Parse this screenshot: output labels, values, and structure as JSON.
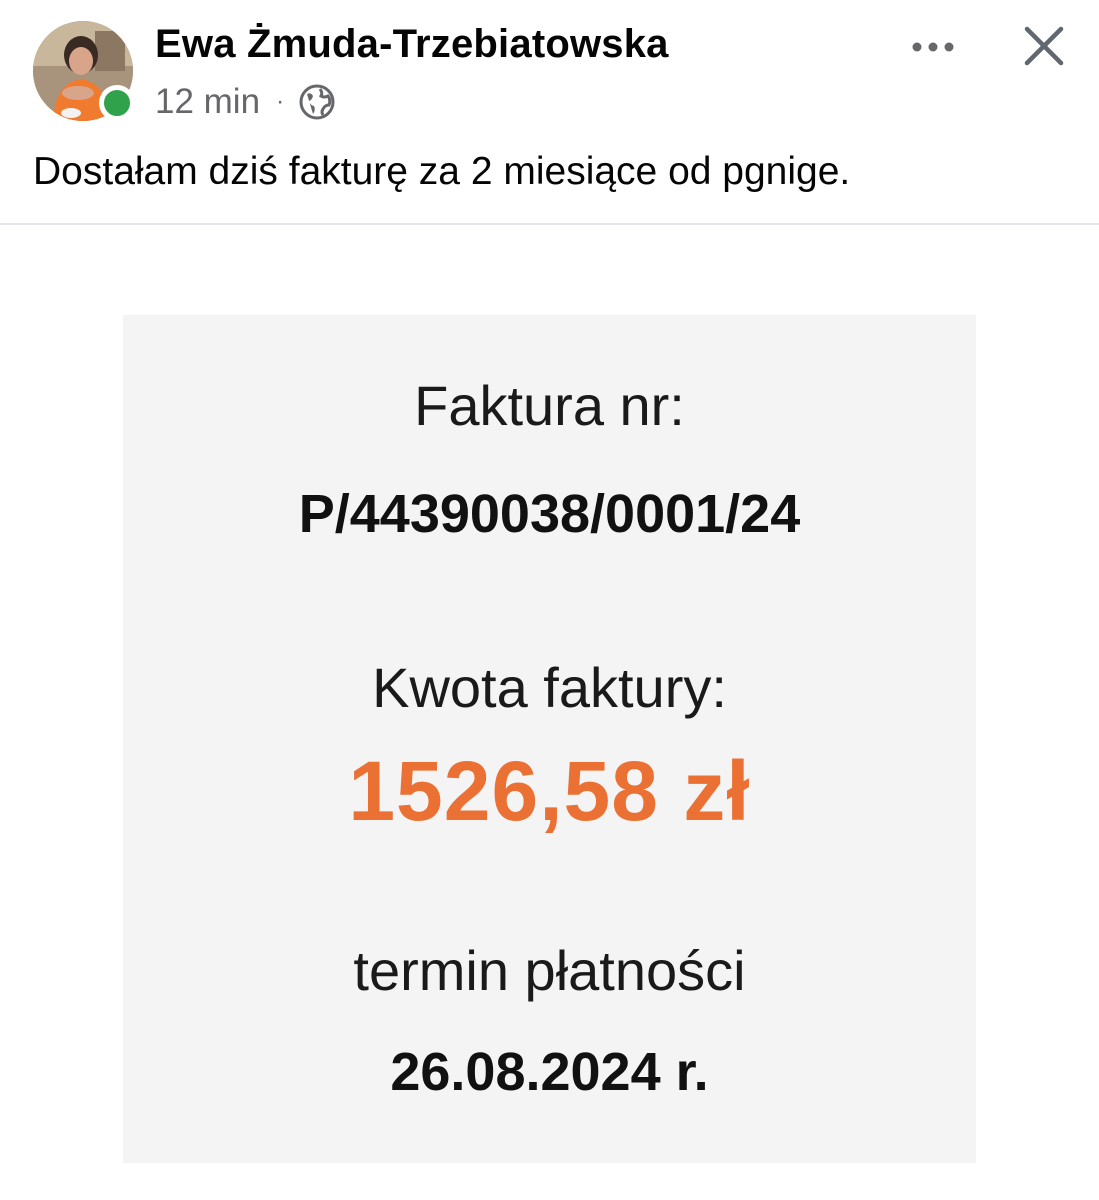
{
  "post": {
    "author": "Ewa Żmuda-Trzebiatowska",
    "time": "12 min",
    "separator": "·",
    "audience_icon": "globe-icon",
    "online": true,
    "text": "Dostałam dziś fakturę za 2 miesiące od pgnige.",
    "actions": {
      "more_icon": "more-horizontal-icon",
      "close_icon": "close-icon"
    }
  },
  "invoice_image": {
    "invoice_label": "Faktura nr:",
    "invoice_number": "P/44390038/0001/24",
    "amount_label": "Kwota faktury:",
    "amount": "1526,58 zł",
    "due_label": "termin płatności",
    "due_date": "26.08.2024 r."
  },
  "colors": {
    "amount": "#eb7034",
    "online_dot": "#31a24c",
    "meta_text": "#65676b",
    "card_background": "#f4f4f4"
  }
}
